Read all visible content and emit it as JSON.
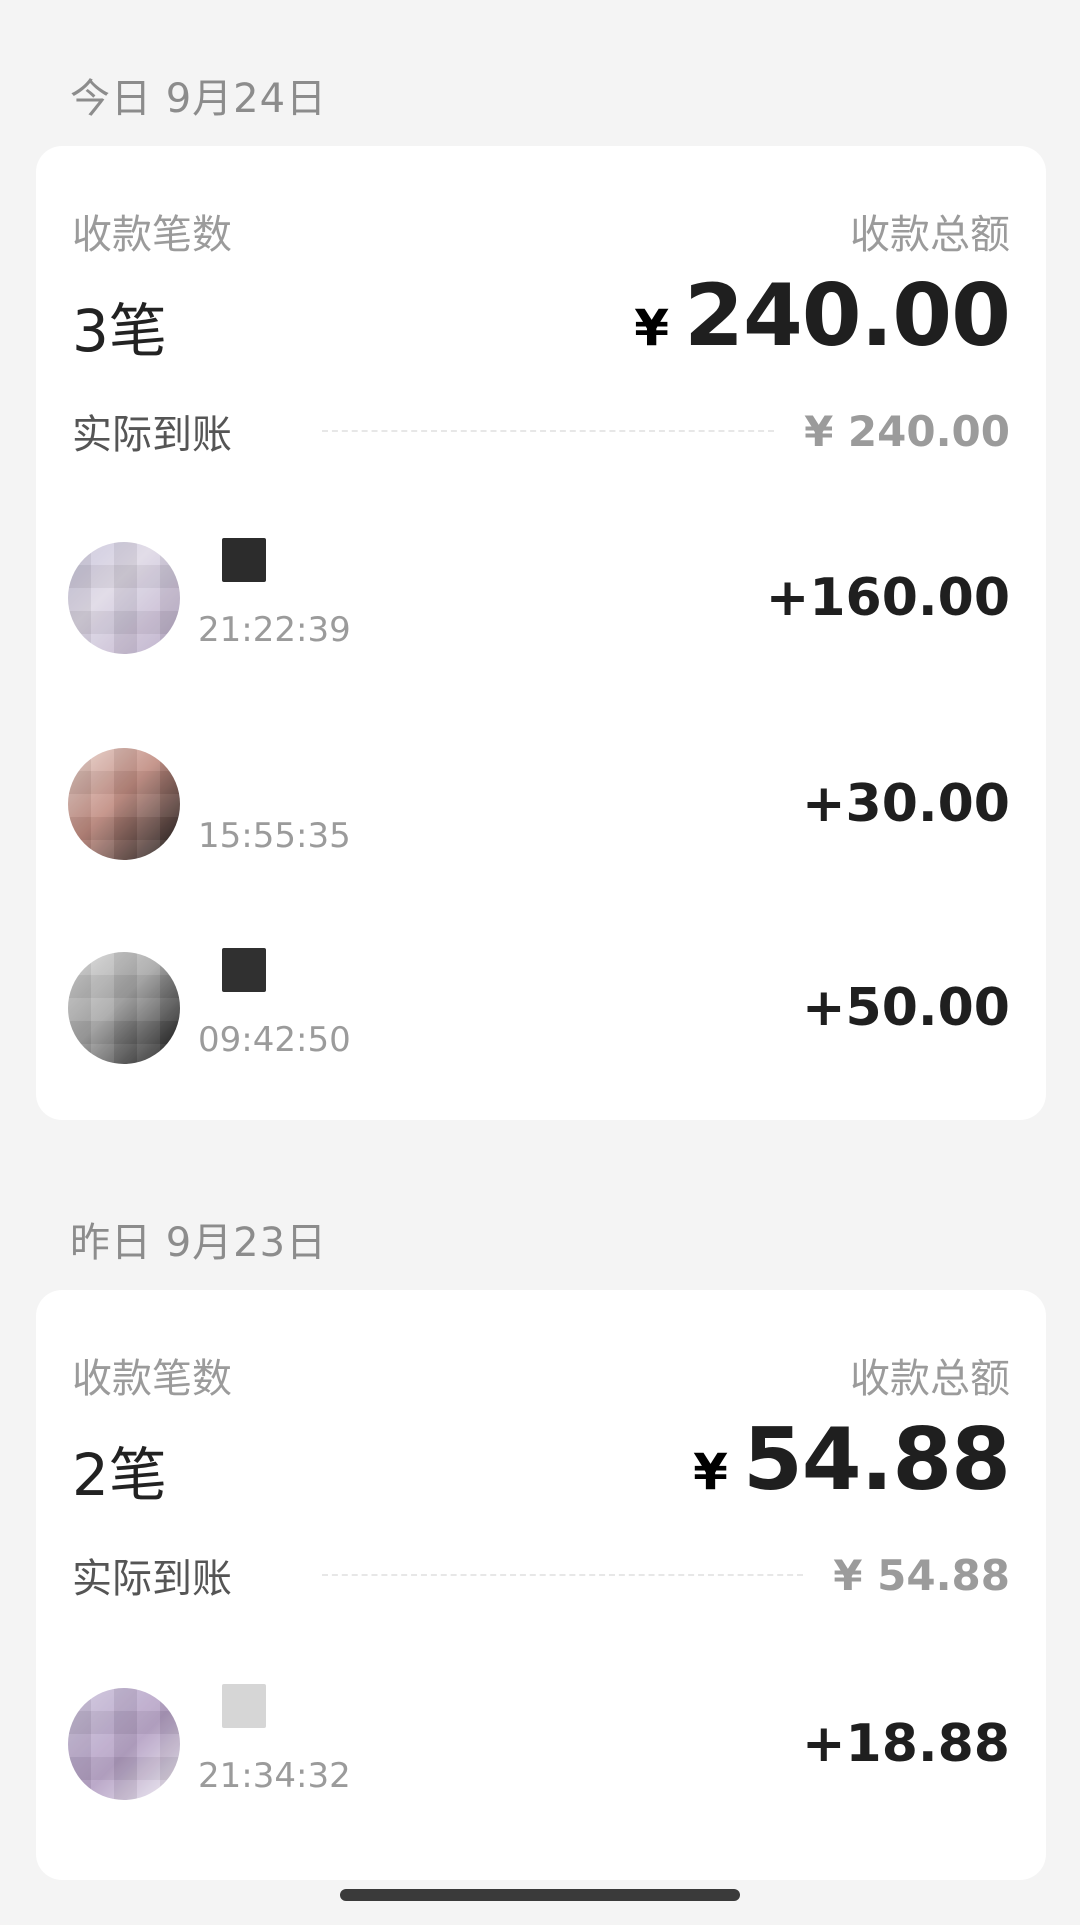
{
  "sections": [
    {
      "title": "今日 9月24日",
      "count_label": "收款笔数",
      "count_value": "3笔",
      "total_label": "收款总额",
      "total_currency": "¥",
      "total_value": "240.00",
      "actual_label": "实际到账",
      "actual_value": "¥ 240.00",
      "transactions": [
        {
          "time": "21:22:39",
          "amount": "+160.00"
        },
        {
          "time": "15:55:35",
          "amount": "+30.00"
        },
        {
          "time": "09:42:50",
          "amount": "+50.00"
        }
      ]
    },
    {
      "title": "昨日 9月23日",
      "count_label": "收款笔数",
      "count_value": "2笔",
      "total_label": "收款总额",
      "total_currency": "¥",
      "total_value": "54.88",
      "actual_label": "实际到账",
      "actual_value": "¥ 54.88",
      "transactions": [
        {
          "time": "21:34:32",
          "amount": "+18.88"
        }
      ]
    }
  ],
  "icons": {
    "avatar": "avatar",
    "home-indicator": "home-indicator"
  }
}
